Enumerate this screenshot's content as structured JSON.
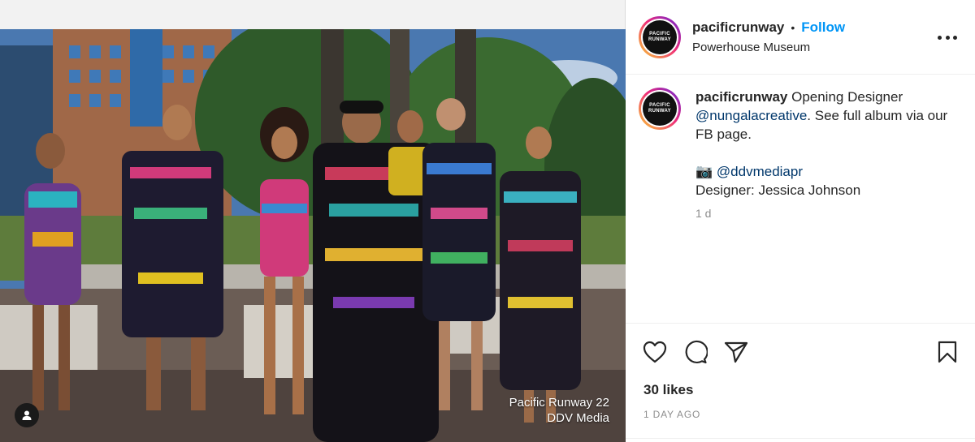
{
  "post": {
    "photo_overlay_line1": "Pacific Runway 22",
    "photo_overlay_line2": "DDV Media",
    "tag_icon": "person-tag-icon"
  },
  "header": {
    "username": "pacificrunway",
    "separator": "•",
    "follow_label": "Follow",
    "location": "Powerhouse Museum",
    "avatar_text_line1": "PACIFIC",
    "avatar_text_line2": "RUNWAY",
    "more_icon": "more-options-icon"
  },
  "caption": {
    "username": "pacificrunway",
    "text_part1": " Opening Designer ",
    "mention1": "@nungalacreative",
    "text_part2": ". See full album via our FB page.",
    "camera_emoji": "📷",
    "mention2": "@ddvmediapr",
    "designer_line": "Designer: Jessica Johnson",
    "time": "1 d"
  },
  "actions": {
    "like_icon": "heart-icon",
    "comment_icon": "comment-icon",
    "share_icon": "share-icon",
    "save_icon": "bookmark-icon",
    "likes": "30 likes",
    "posted": "1 DAY AGO"
  },
  "colors": {
    "accent": "#0095f6",
    "mention": "#00376b",
    "muted": "#8e8e8e"
  }
}
